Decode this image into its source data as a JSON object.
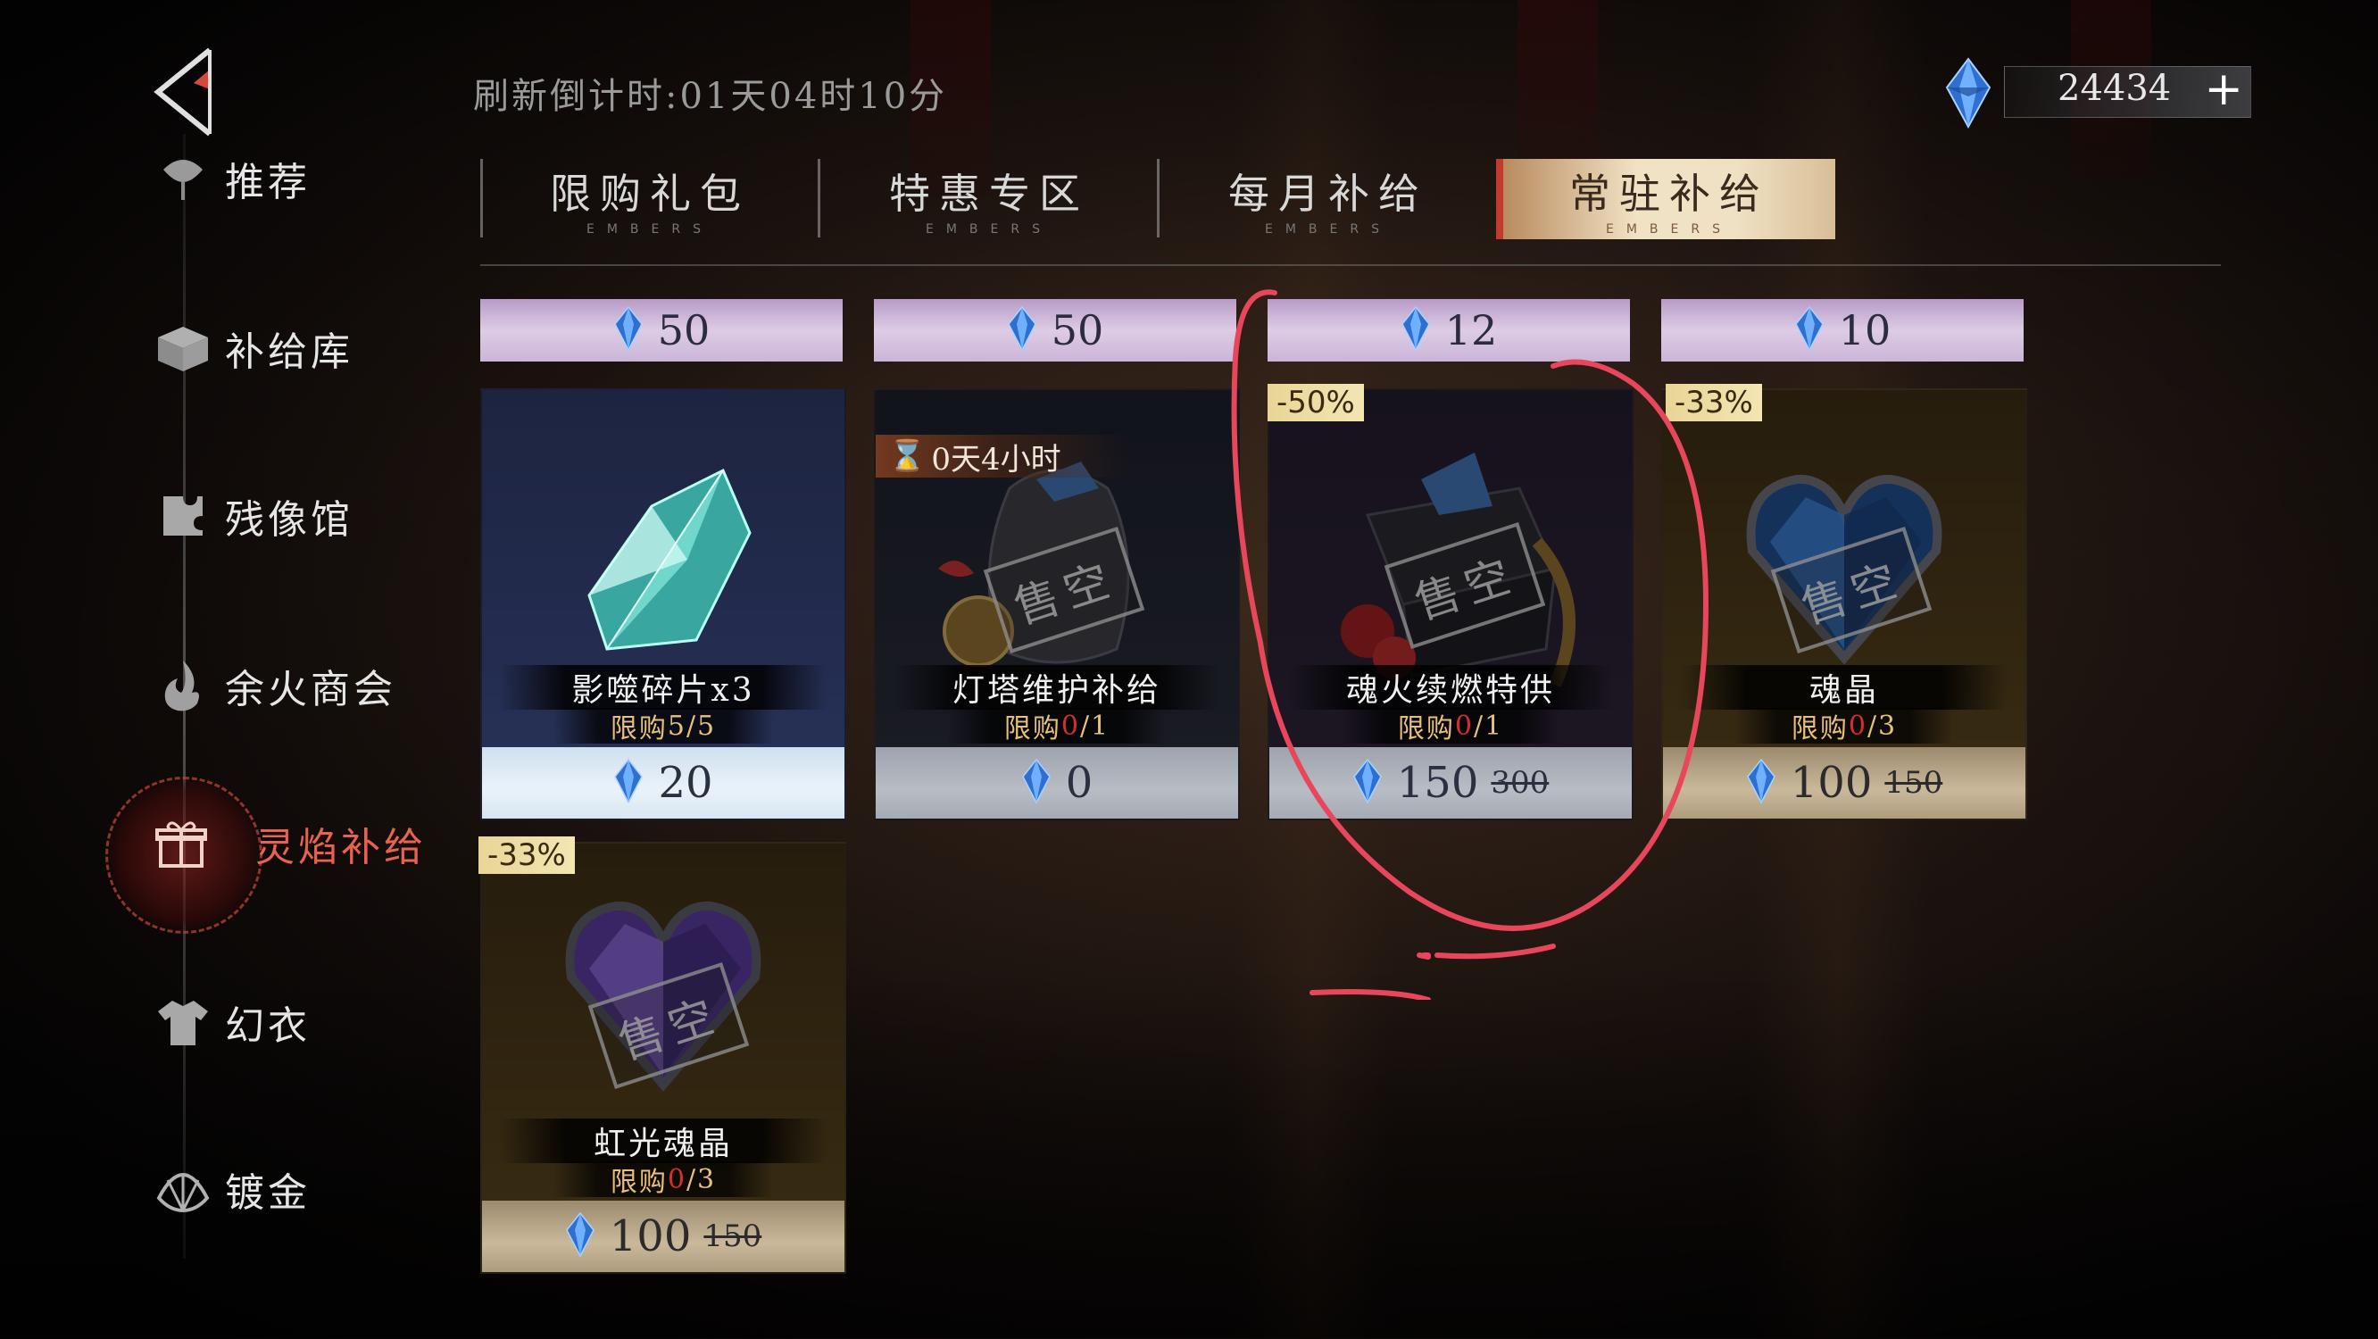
{
  "header": {
    "refresh_text": "刷新倒计时:01天04时10分",
    "currency_amount": "24434",
    "currency_plus": "+",
    "currency_icon": "blue-crystal-gem-icon"
  },
  "sidebar": {
    "items": [
      {
        "label": "推荐",
        "icon": "lamp-icon"
      },
      {
        "label": "补给库",
        "icon": "crate-icon"
      },
      {
        "label": "残像馆",
        "icon": "puzzle-icon"
      },
      {
        "label": "余火商会",
        "icon": "flame-swirl-icon"
      },
      {
        "label": "灵焰补给",
        "icon": "gift-icon",
        "active": true
      },
      {
        "label": "幻衣",
        "icon": "shirt-icon"
      },
      {
        "label": "镀金",
        "icon": "shell-icon"
      }
    ]
  },
  "tabs": [
    {
      "label": "限购礼包",
      "sub": "EMBERS"
    },
    {
      "label": "特惠专区",
      "sub": "EMBERS"
    },
    {
      "label": "每月补给",
      "sub": "EMBERS"
    },
    {
      "label": "常驻补给",
      "sub": "EMBERS",
      "active": true
    }
  ],
  "top_prices": [
    "50",
    "50",
    "12",
    "10"
  ],
  "cards": [
    {
      "name": "影噬碎片x3",
      "limit_prefix": "限购 ",
      "limit_used": "5",
      "limit_total": "/5",
      "price": "20",
      "sold_out": false
    },
    {
      "name": "灯塔维护补给",
      "limit_prefix": "限购 ",
      "limit_used": "0",
      "limit_total": "/1",
      "price": "0",
      "sold_out": true,
      "timer": "0天4小时"
    },
    {
      "name": "魂火续燃特供",
      "limit_prefix": "限购 ",
      "limit_used": "0",
      "limit_total": "/1",
      "price": "150",
      "old_price": "300",
      "discount": "-50%",
      "sold_out": true
    },
    {
      "name": "魂晶",
      "limit_prefix": "限购 ",
      "limit_used": "0",
      "limit_total": "/3",
      "price": "100",
      "old_price": "150",
      "discount": "-33%",
      "sold_out": true
    },
    {
      "name": "虹光魂晶",
      "limit_prefix": "限购 ",
      "limit_used": "0",
      "limit_total": "/3",
      "price": "100",
      "old_price": "150",
      "discount": "-33%",
      "sold_out": true
    }
  ],
  "sold_out_stamp": "售空",
  "colors": {
    "accent_red": "#e8624f",
    "annotation_red": "#e8465a",
    "tab_active_gold": "#efe1c4"
  }
}
